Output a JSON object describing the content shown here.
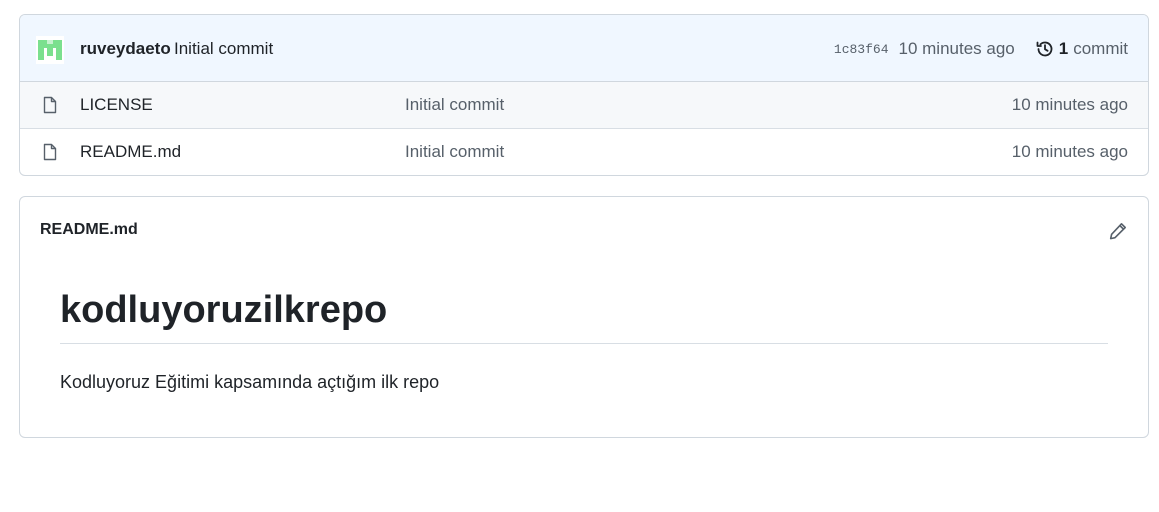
{
  "latest_commit": {
    "author": "ruveydaeto",
    "message": "Initial commit",
    "sha": "1c83f64",
    "time": "10 minutes ago",
    "history_count": "1",
    "history_label": "commit",
    "avatar_color": "#7be08e"
  },
  "files": [
    {
      "name": "LICENSE",
      "commit_message": "Initial commit",
      "time": "10 minutes ago",
      "icon": "file-icon"
    },
    {
      "name": "README.md",
      "commit_message": "Initial commit",
      "time": "10 minutes ago",
      "icon": "file-icon"
    }
  ],
  "readme": {
    "filename": "README.md",
    "heading": "kodluyoruzilkrepo",
    "paragraph": "Kodluyoruz Eğitimi kapsamında açtığım ilk repo",
    "edit_icon": "pencil-icon"
  },
  "colors": {
    "border": "#d0d7de",
    "muted_text": "#57606a",
    "commit_bar_bg": "#f0f7ff"
  }
}
